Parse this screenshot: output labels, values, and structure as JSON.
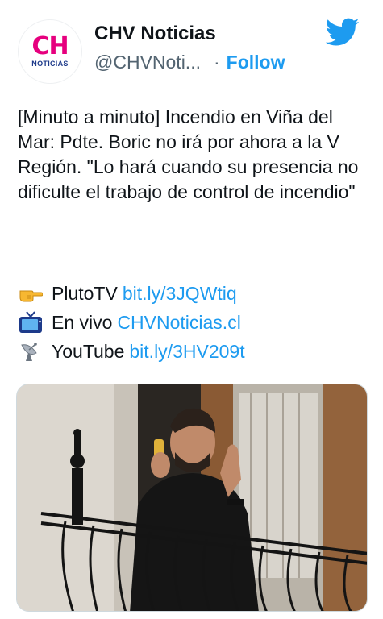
{
  "author": {
    "avatar_logo_text": "CH",
    "avatar_logo_sub": "NOTICIAS",
    "name": "CHV Noticias",
    "handle": "@CHVNoti...",
    "separator": "·",
    "follow_label": "Follow"
  },
  "tweet": {
    "text": "[Minuto a minuto] Incendio en Viña del Mar: Pdte. Boric no irá por ahora a la V Región. \"Lo hará cuando su presencia no dificulte el trabajo de control de incendio\"",
    "links": [
      {
        "icon": "pointing-hand-icon",
        "label": "PlutoTV",
        "url": "bit.ly/3JQWtiq"
      },
      {
        "icon": "television-icon",
        "label": "En vivo",
        "url": "CHVNoticias.cl"
      },
      {
        "icon": "satellite-dish-icon",
        "label": "YouTube",
        "url": "bit.ly/3HV209t"
      }
    ]
  },
  "colors": {
    "brand_pink": "#e6007e",
    "link_blue": "#1d9bf0",
    "muted": "#536471"
  }
}
